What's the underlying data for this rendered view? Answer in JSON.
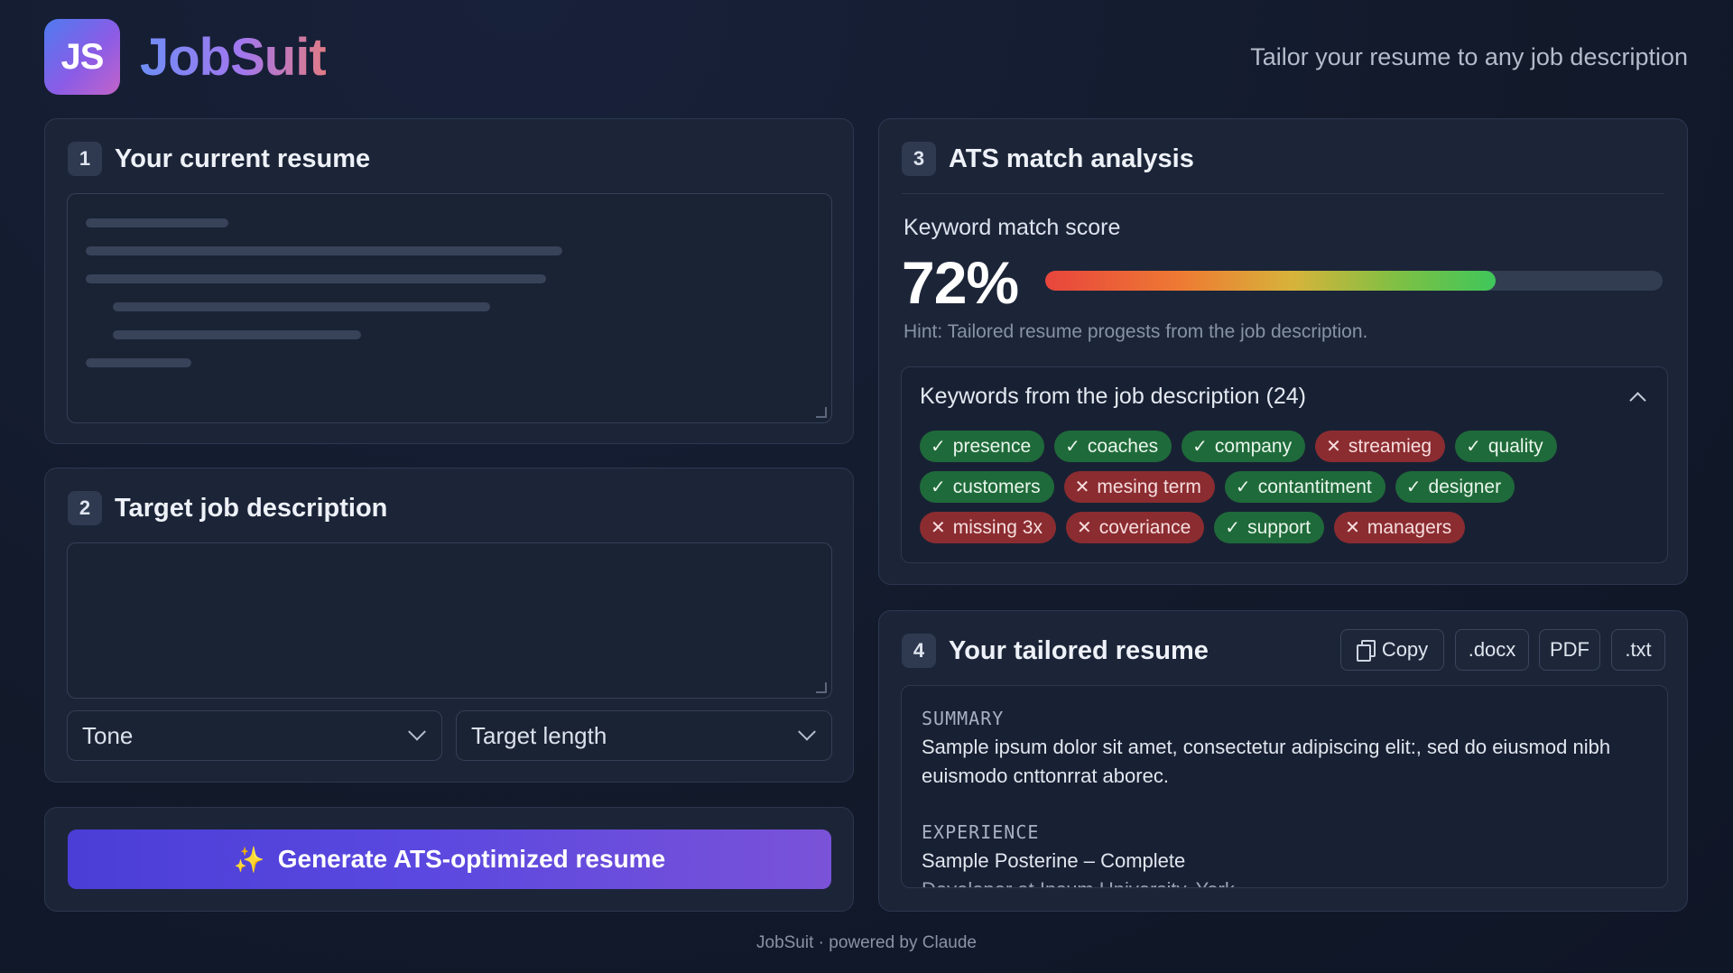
{
  "header": {
    "logo_text": "JS",
    "brand": "JobSuit",
    "tagline": "Tailor your resume to any job description"
  },
  "resume_card": {
    "step": "1",
    "title": "Your current resume"
  },
  "job_card": {
    "step": "2",
    "title": "Target job description",
    "tone_label": "Tone",
    "length_label": "Target length"
  },
  "generate": {
    "icon": "✨",
    "label": "Generate ATS-optimized resume"
  },
  "ats": {
    "step": "3",
    "title": "ATS match analysis",
    "score_label": "Keyword match score",
    "score_text": "72%",
    "score_fraction": 0.73,
    "hint": "Hint: Tailored resume progests from the job description.",
    "keywords_title": "Keywords from the job description (24)",
    "keywords": [
      {
        "text": "presence",
        "matched": true
      },
      {
        "text": "coaches",
        "matched": true
      },
      {
        "text": "company",
        "matched": true
      },
      {
        "text": "streamieg",
        "matched": false
      },
      {
        "text": "quality",
        "matched": true
      },
      {
        "text": "customers",
        "matched": true
      },
      {
        "text": "mesing term",
        "matched": false
      },
      {
        "text": "contantitment",
        "matched": true
      },
      {
        "text": "designer",
        "matched": true
      },
      {
        "text": "missing 3x",
        "matched": false
      },
      {
        "text": "coveriance",
        "matched": false
      },
      {
        "text": "support",
        "matched": true
      },
      {
        "text": "managers",
        "matched": false
      }
    ],
    "colors": {
      "matched": "#1f6a3a",
      "missing": "#8b2c31"
    }
  },
  "tailored": {
    "step": "4",
    "title": "Your tailored resume",
    "copy_label": "Copy",
    "docx_label": ".docx",
    "pdf_label": "PDF",
    "txt_label": ".txt",
    "summary_head": "SUMMARY",
    "summary_text": "Sample ipsum dolor sit amet, consectetur adipiscing elit:, sed do eiusmod nibh euismodo cnttonrrat aborec.",
    "experience_head": "EXPERIENCE",
    "experience_text": "Sample Posterine – Complete",
    "experience_more": "Developer at Ipsum University, York"
  },
  "footer": "JobSuit · powered by Claude",
  "accent_colors": {
    "primary_button": "#5a48e0",
    "background": "#121a2b",
    "card": "#1c2538"
  }
}
